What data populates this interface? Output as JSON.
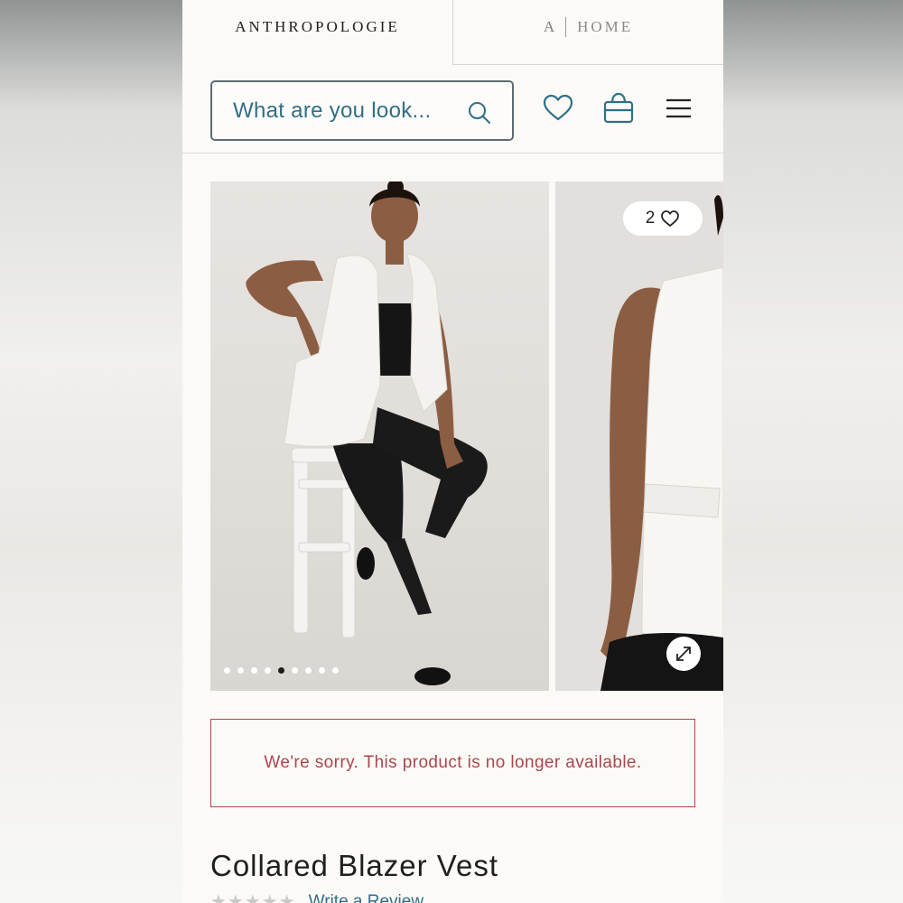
{
  "brand_tabs": {
    "anthropologie": "ANTHROPOLOGIE",
    "home_a": "A",
    "home": "HOME"
  },
  "header": {
    "search_placeholder": "What are you look...",
    "icons": [
      "search-icon",
      "heart-icon",
      "shopping-bag-icon",
      "hamburger-menu-icon"
    ]
  },
  "gallery": {
    "image_count": 9,
    "active_image_index": 4,
    "favorites_count": "2",
    "icons": [
      "heart-icon",
      "expand-icon"
    ]
  },
  "notice": {
    "message": "We're sorry. This product is no longer available."
  },
  "product": {
    "title": "Collared Blazer Vest",
    "stars": "★★★★★",
    "review_link": "Write a Review"
  },
  "colors": {
    "accent_teal": "#2f6f86",
    "notice_red": "#a9474d",
    "text_dark": "#1f1f1f",
    "page_bg": "#fbfaf7"
  }
}
